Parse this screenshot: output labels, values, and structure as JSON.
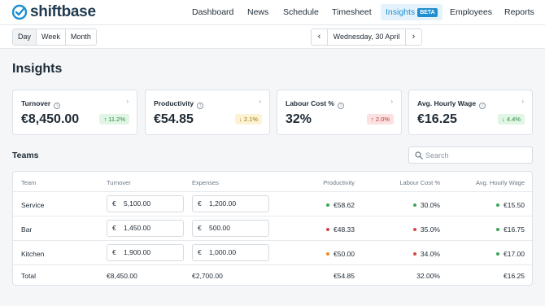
{
  "app": {
    "logo_text": "shiftbase",
    "nav": [
      {
        "label": "Dashboard",
        "active": false
      },
      {
        "label": "News",
        "active": false
      },
      {
        "label": "Schedule",
        "active": false
      },
      {
        "label": "Timesheet",
        "active": false
      },
      {
        "label": "Insights",
        "active": true,
        "badge": "BETA"
      },
      {
        "label": "Employees",
        "active": false
      },
      {
        "label": "Reports",
        "active": false
      }
    ],
    "brand_color": "#1f8fcf"
  },
  "toolbar": {
    "views": [
      "Day",
      "Week",
      "Month"
    ],
    "selected_view": "Day",
    "date": "Wednesday, 30 April",
    "prev_icon": "chevron-left-icon",
    "next_icon": "chevron-right-icon"
  },
  "page_title": "Insights",
  "cards": [
    {
      "label": "Turnover",
      "value": "€8,450.00",
      "change": "11.2%",
      "direction": "up",
      "tone": "green"
    },
    {
      "label": "Productivity",
      "value": "€54.85",
      "change": "2.1%",
      "direction": "down",
      "tone": "yellow"
    },
    {
      "label": "Labour Cost %",
      "value": "32%",
      "change": "2.0%",
      "direction": "up",
      "tone": "red"
    },
    {
      "label": "Avg. Hourly Wage",
      "value": "€16.25",
      "change": "4.4%",
      "direction": "down",
      "tone": "green"
    }
  ],
  "teams": {
    "title": "Teams",
    "search_placeholder": "Search",
    "columns": [
      "Team",
      "Turnover",
      "Expenses",
      "Productivity",
      "Labour Cost %",
      "Avg. Hourly Wage"
    ],
    "currency_symbol": "€",
    "rows": [
      {
        "team": "Service",
        "turnover": "5,100.00",
        "expenses": "1,200.00",
        "productivity": "€58.62",
        "productivity_color": "#3aa655",
        "labour": "30.0%",
        "labour_color": "#3aa655",
        "wage": "€15.50",
        "wage_color": "#3aa655"
      },
      {
        "team": "Bar",
        "turnover": "1,450.00",
        "expenses": "500.00",
        "productivity": "€48.33",
        "productivity_color": "#d64545",
        "labour": "35.0%",
        "labour_color": "#d64545",
        "wage": "€16.75",
        "wage_color": "#3aa655"
      },
      {
        "team": "Kitchen",
        "turnover": "1,900.00",
        "expenses": "1,000.00",
        "productivity": "€50.00",
        "productivity_color": "#f08a24",
        "labour": "34.0%",
        "labour_color": "#d64545",
        "wage": "€17.00",
        "wage_color": "#3aa655"
      }
    ],
    "total": {
      "label": "Total",
      "turnover": "€8,450.00",
      "expenses": "€2,700.00",
      "productivity": "€54.85",
      "labour": "32.00%",
      "wage": "€16.25"
    }
  }
}
